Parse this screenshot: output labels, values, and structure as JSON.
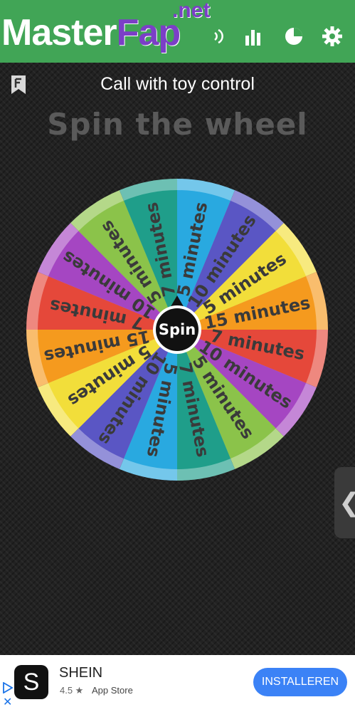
{
  "header": {
    "brand_main_a": "Master",
    "brand_main_b": "Fap",
    "brand_net": ".net",
    "icons": [
      "sound-icon",
      "stats-icon",
      "pie-chart-icon",
      "gear-icon"
    ]
  },
  "page": {
    "title": "Call with toy control",
    "heading": "Spin the wheel",
    "spin_label": "Spin"
  },
  "wheel": {
    "segments": [
      {
        "label": "5 minutes",
        "color": "#29a9e0"
      },
      {
        "label": "10 minutes",
        "color": "#5a56c4"
      },
      {
        "label": "5 minutes",
        "color": "#f2de3a"
      },
      {
        "label": "15 minutes",
        "color": "#f59a1e"
      },
      {
        "label": "7 minutes",
        "color": "#e5483a"
      },
      {
        "label": "10 minutes",
        "color": "#a546c2"
      },
      {
        "label": "5 minutes",
        "color": "#8bc34a"
      },
      {
        "label": "7 minutes",
        "color": "#1f9e8a"
      },
      {
        "label": "5 minutes",
        "color": "#29a9e0"
      },
      {
        "label": "10 minutes",
        "color": "#5a56c4"
      },
      {
        "label": "5 minutes",
        "color": "#f2de3a"
      },
      {
        "label": "15 minutes",
        "color": "#f59a1e"
      },
      {
        "label": "7 minutes",
        "color": "#e5483a"
      },
      {
        "label": "10 minutes",
        "color": "#a546c2"
      },
      {
        "label": "5 minutes",
        "color": "#8bc34a"
      },
      {
        "label": "7 minutes",
        "color": "#1f9e8a"
      }
    ]
  },
  "ad": {
    "name": "SHEIN",
    "logo_letter": "S",
    "rating": "4.5 ★",
    "store": "App Store",
    "install_label": "INSTALLEREN"
  },
  "side_tab": {
    "glyph": "❮"
  },
  "colors": {
    "header_bg": "#41a556",
    "accent": "#3b82f6"
  }
}
